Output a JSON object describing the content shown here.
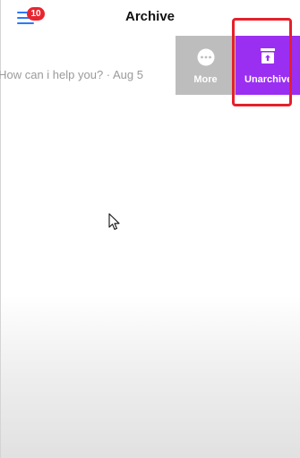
{
  "header": {
    "title": "Archive",
    "badge_count": "10"
  },
  "conversation": {
    "preview_text": "How can i help you? · Aug 5"
  },
  "swipe_actions": {
    "more_label": "More",
    "unarchive_label": "Unarchive"
  },
  "colors": {
    "unarchive_bg": "#9a2ff2",
    "more_bg": "#bdbdbd",
    "badge_bg": "#e8262f",
    "menu_icon": "#2979ff",
    "highlight_border": "#e5202b"
  },
  "icons": {
    "menu": "hamburger-menu-icon",
    "more": "more-dots-icon",
    "unarchive": "unarchive-box-icon",
    "cursor": "mouse-pointer-icon"
  }
}
